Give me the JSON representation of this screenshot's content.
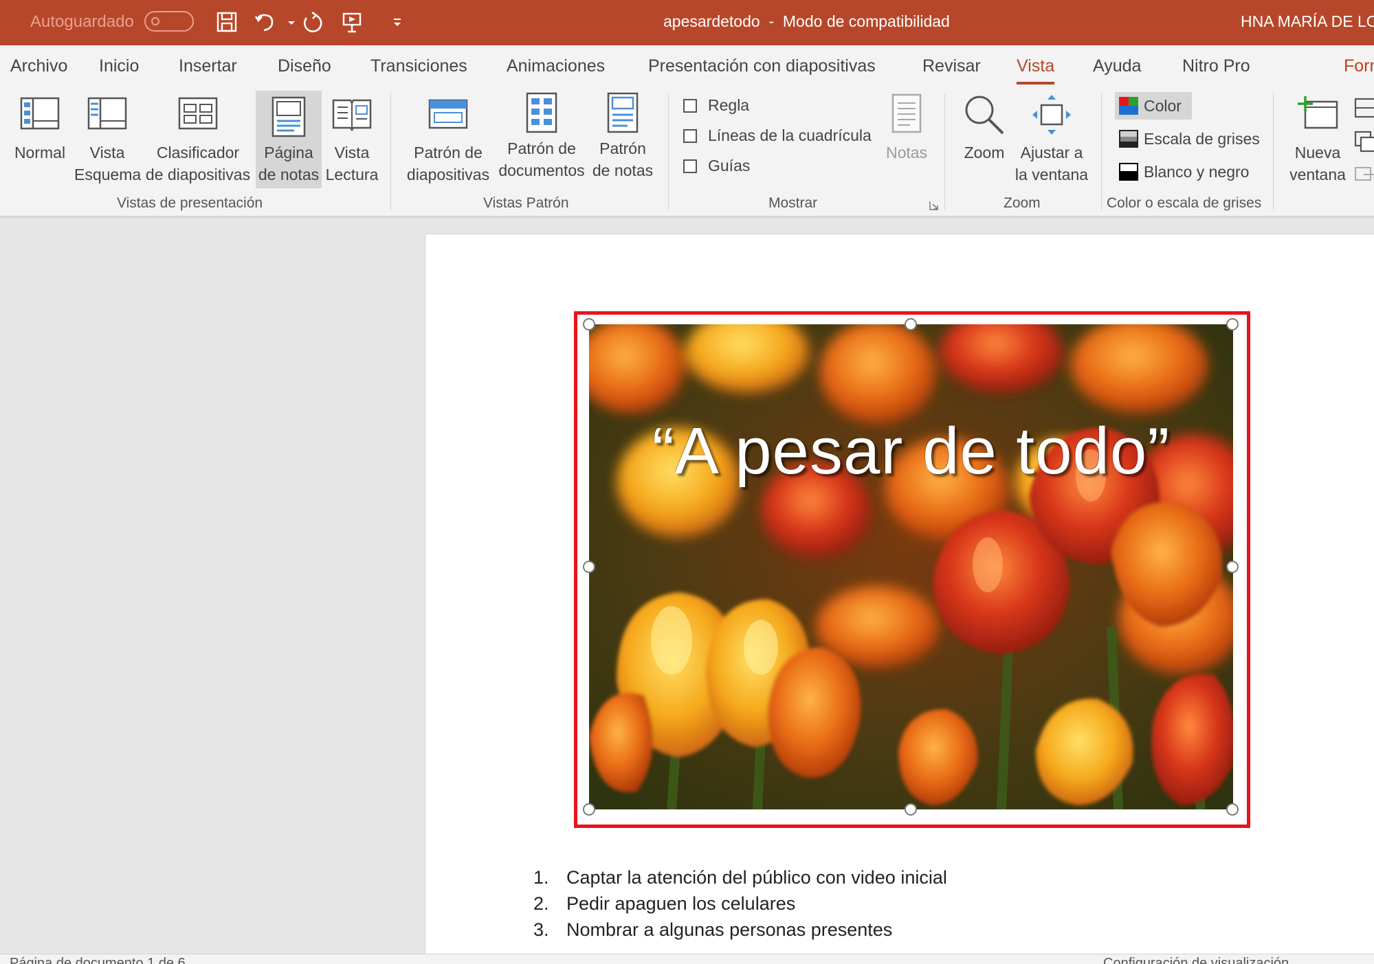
{
  "titlebar": {
    "autosave_label": "Autoguardado",
    "document_title": "apesardetodo  -  Modo de compatibilidad",
    "user_name": "HNA MARÍA DE LO",
    "bg_color": "#b7472a",
    "qat_icons": [
      "save-icon",
      "undo-icon",
      "redo-icon",
      "present-from-start-icon",
      "customize-qat-icon"
    ]
  },
  "tabs": [
    {
      "label": "Archivo"
    },
    {
      "label": "Inicio"
    },
    {
      "label": "Insertar"
    },
    {
      "label": "Diseño"
    },
    {
      "label": "Transiciones"
    },
    {
      "label": "Animaciones"
    },
    {
      "label": "Presentación con diapositivas"
    },
    {
      "label": "Revisar"
    },
    {
      "label": "Vista",
      "active": true
    },
    {
      "label": "Ayuda"
    },
    {
      "label": "Nitro Pro"
    },
    {
      "label": "Forn"
    }
  ],
  "ribbon": {
    "presentation_views": {
      "group_label": "Vistas de presentación",
      "normal": "Normal",
      "outline_1": "Vista",
      "outline_2": "Esquema",
      "sorter_1": "Clasificador",
      "sorter_2": "de diapositivas",
      "notes_page_1": "Página",
      "notes_page_2": "de notas",
      "reading_1": "Vista",
      "reading_2": "Lectura"
    },
    "master_views": {
      "group_label": "Vistas Patrón",
      "slide_master_1": "Patrón de",
      "slide_master_2": "diapositivas",
      "handout_master_1": "Patrón de",
      "handout_master_2": "documentos",
      "notes_master_1": "Patrón",
      "notes_master_2": "de notas"
    },
    "show": {
      "group_label": "Mostrar",
      "ruler": "Regla",
      "gridlines": "Líneas de la cuadrícula",
      "guides": "Guías",
      "notes": "Notas"
    },
    "zoom": {
      "group_label": "Zoom",
      "zoom": "Zoom",
      "fit_1": "Ajustar a",
      "fit_2": "la ventana"
    },
    "color_grayscale": {
      "group_label": "Color o escala de grises",
      "color": "Color",
      "grayscale": "Escala de grises",
      "black_white": "Blanco y negro"
    },
    "window": {
      "new_window_1": "Nueva",
      "new_window_2": "ventana"
    }
  },
  "slide": {
    "title": "“A pesar de todo”",
    "image_subject": "orange and red tulips"
  },
  "notes": {
    "items": [
      {
        "num": "1.",
        "text": "Captar la atención del público con video inicial"
      },
      {
        "num": "2.",
        "text": "Pedir apaguen los celulares"
      },
      {
        "num": "3.",
        "text": "Nombrar a algunas personas presentes"
      }
    ]
  },
  "statusbar": {
    "left_text": "Página de documento 1 de 6",
    "right_text": "Configuración de visualización"
  },
  "colors": {
    "accent": "#b7472a",
    "selection_border": "#e8141c"
  }
}
